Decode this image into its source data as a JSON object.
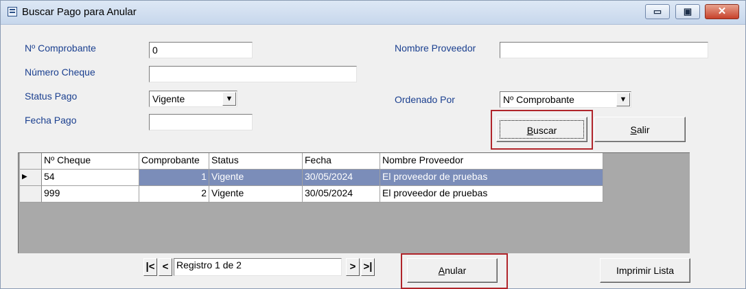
{
  "window": {
    "title": "Buscar Pago para Anular",
    "controls": {
      "minimize": "▭",
      "maximize": "▣",
      "close": "✕"
    }
  },
  "form": {
    "comprobante_label": "Nº Comprobante",
    "comprobante_value": "0",
    "cheque_label": "Número Cheque",
    "cheque_value": "",
    "status_label": "Status Pago",
    "status_value": "Vigente",
    "fecha_label": "Fecha Pago",
    "fecha_value": "",
    "proveedor_label": "Nombre Proveedor",
    "proveedor_value": "",
    "orden_label": "Ordenado Por",
    "orden_value": "Nº Comprobante"
  },
  "buttons": {
    "buscar": "Buscar",
    "salir": "Salir",
    "anular": "Anular",
    "imprimir": "Imprimir Lista"
  },
  "grid": {
    "headers": [
      "Nº Cheque",
      "Comprobante",
      "Status",
      "Fecha",
      "Nombre Proveedor"
    ],
    "rows": [
      {
        "pointer": "▶",
        "cheque": "54",
        "comprobante": "1",
        "status": "Vigente",
        "fecha": "30/05/2024",
        "proveedor": "El proveedor de pruebas"
      },
      {
        "pointer": "",
        "cheque": "999",
        "comprobante": "2",
        "status": "Vigente",
        "fecha": "30/05/2024",
        "proveedor": "El proveedor de pruebas"
      }
    ]
  },
  "navigator": {
    "first": "|<",
    "prev": "<",
    "record_text": "Registro 1 de 2",
    "next": ">",
    "last": ">|"
  },
  "colors": {
    "label_blue": "#1a3f8f",
    "selected_row": "#7b8db9",
    "highlight_red": "#b0242a"
  },
  "icons": [
    "app-icon",
    "minimize-icon",
    "maximize-icon",
    "close-icon",
    "dropdown-arrow-icon",
    "row-pointer-icon"
  ]
}
